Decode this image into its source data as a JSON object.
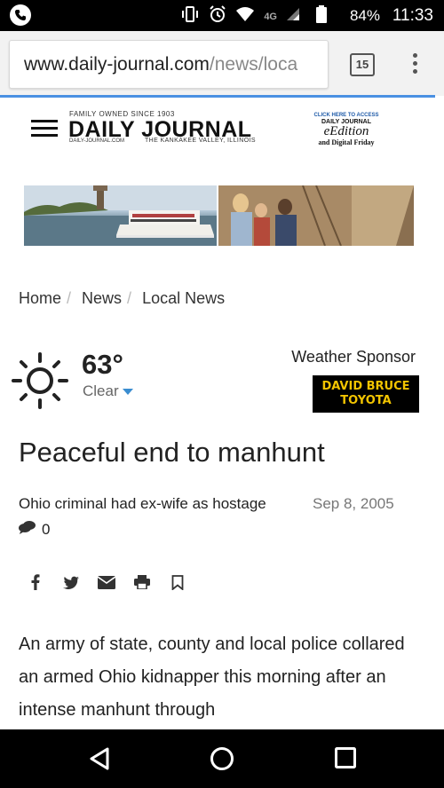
{
  "status_bar": {
    "battery": "84%",
    "time": "11:33",
    "network": "4G"
  },
  "browser": {
    "url_host": "www.daily-journal.com",
    "url_path": "/news/loca",
    "tab_count": "15"
  },
  "masthead": {
    "tagline_top": "FAMILY OWNED SINCE 1903",
    "title": "DAILY JOURNAL",
    "site": "DAILY-JOURNAL.COM",
    "region": "THE KANKAKEE VALLEY, ILLINOIS",
    "edition_click": "CLICK HERE TO ACCESS",
    "edition_paper": "DAILY JOURNAL",
    "edition_name": "eEdition",
    "edition_sub": "and Digital Friday"
  },
  "breadcrumb": [
    "Home",
    "News",
    "Local News"
  ],
  "weather": {
    "temperature": "63°",
    "condition": "Clear",
    "sponsor_label": "Weather Sponsor",
    "sponsor_line1": "DAVID BRUCE",
    "sponsor_line2": "TOYOTA"
  },
  "article": {
    "headline": "Peaceful end to manhunt",
    "subheadline": "Ohio criminal had ex-wife as hostage",
    "date": "Sep 8, 2005",
    "comment_count": "0",
    "body": "An army of state, county and local police collared an armed Ohio kidnapper this morning after an intense manhunt through"
  },
  "colors": {
    "accent": "#4a90e2",
    "sponsor_bg": "#000000",
    "sponsor_text": "#f2c400"
  }
}
